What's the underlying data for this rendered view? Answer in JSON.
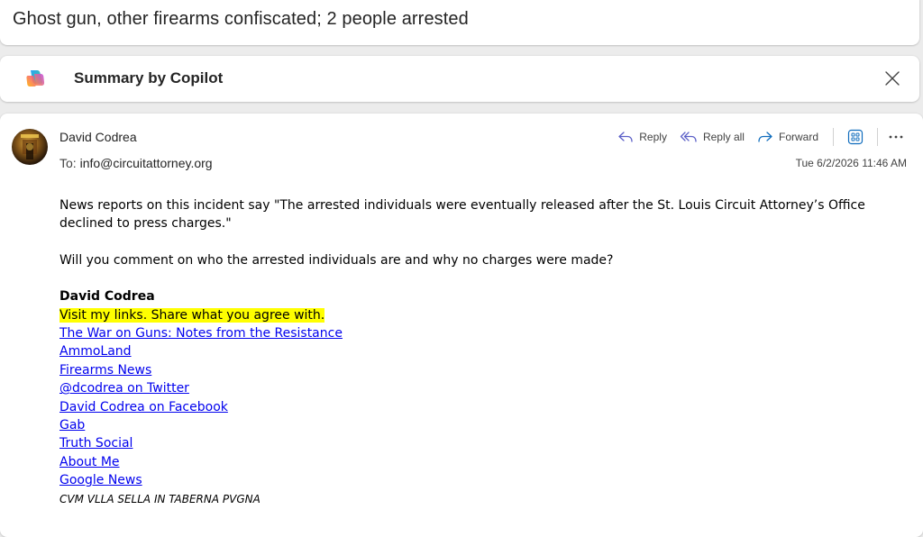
{
  "subject": "Ghost gun, other firearms confiscated; 2 people arrested",
  "copilot": {
    "title": "Summary by Copilot",
    "logo_icon": "copilot-logo",
    "close_icon": "close-icon"
  },
  "message": {
    "sender": "David Codrea",
    "to_label": "To:",
    "to": "info@circuitattorney.org",
    "timestamp": "Tue 6/2/2026 11:46 AM",
    "actions": {
      "reply": "Reply",
      "reply_all": "Reply all",
      "forward": "Forward"
    },
    "body": {
      "paragraph1": "News reports on this incident say \"The arrested individuals were eventually released after the St. Louis Circuit Attorney’s Office declined to press charges.\"",
      "paragraph2": "Will you comment on who the arrested individuals are and why no charges were made?"
    },
    "signature": {
      "name": "David Codrea",
      "highlight": "Visit my links. Share what you agree with.",
      "links": [
        "The War on Guns: Notes from the Resistance",
        "AmmoLand",
        "Firearms News",
        "@dcodrea on Twitter",
        "David Codrea on Facebook",
        "Gab",
        "Truth Social",
        "About Me",
        "Google News"
      ],
      "motto": "CVM VLLA SELLA IN TABERNA PVGNA"
    }
  },
  "colors": {
    "link": "#0000ee",
    "highlight": "#ffff00",
    "reply_icon": "#5b5fc7",
    "forward_icon": "#0f6cbd"
  }
}
